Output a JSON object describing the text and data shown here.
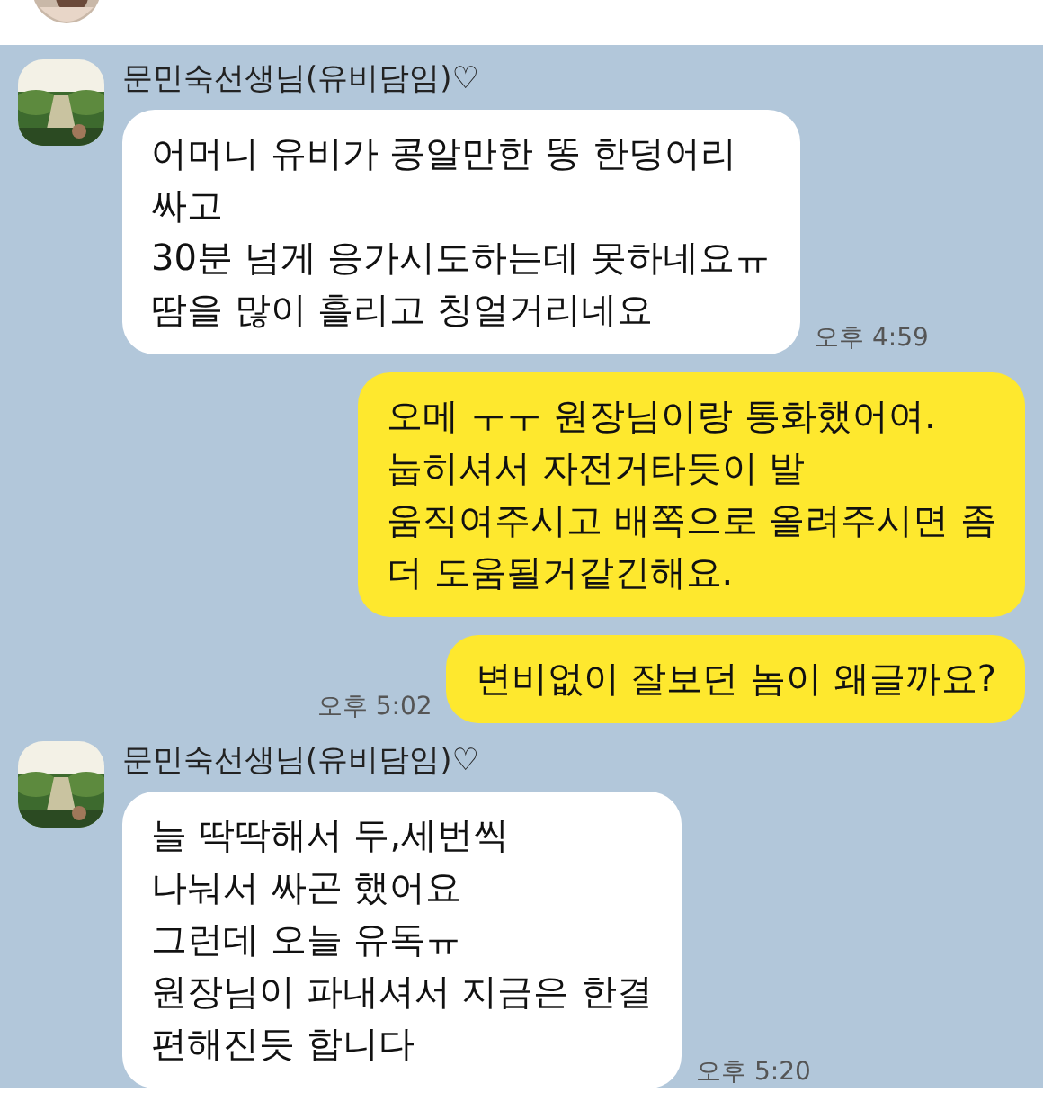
{
  "messages": [
    {
      "kind": "received",
      "sender": "문민숙선생님(유비담임)♡",
      "text": "어머니 유비가 콩알만한 똥 한덩어리\n싸고\n30분 넘게 응가시도하는데 못하네요ㅠ\n땀을 많이 흘리고 칭얼거리네요",
      "time": "오후 4:59"
    },
    {
      "kind": "sent",
      "text": "오메 ㅜㅜ 원장님이랑 통화했어여.\n눕히셔서 자전거타듯이 발\n움직여주시고 배쪽으로 올려주시면 좀\n더 도움될거같긴해요."
    },
    {
      "kind": "sent",
      "text": "변비없이 잘보던 놈이 왜글까요?",
      "time": "오후 5:02"
    },
    {
      "kind": "received",
      "sender": "문민숙선생님(유비담임)♡",
      "text": "늘 딱딱해서 두,세번씩\n나눠서 싸곤 했어요\n그런데 오늘 유독ㅠ\n원장님이 파내셔서 지금은 한결\n편해진듯 합니다",
      "time": "오후 5:20"
    }
  ]
}
